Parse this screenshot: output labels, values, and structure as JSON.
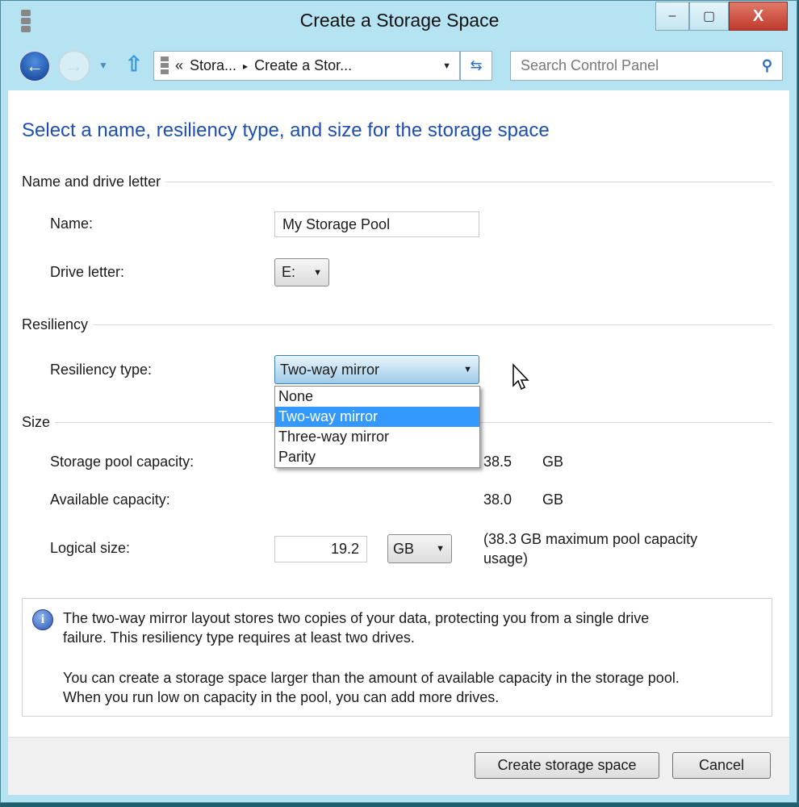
{
  "window": {
    "title": "Create a Storage Space",
    "minimize": "–",
    "maximize": "▢",
    "close": "X"
  },
  "nav": {
    "breadcrumb_prefix": "«",
    "crumb1": "Stora...",
    "separator": "▸",
    "crumb2": "Create a Stor...",
    "search_placeholder": "Search Control Panel"
  },
  "heading": "Select a name, resiliency type, and size for the storage space",
  "name_section": {
    "title": "Name and drive letter",
    "name_label": "Name:",
    "name_value": "My Storage Pool",
    "drive_label": "Drive letter:",
    "drive_value": "E:"
  },
  "resiliency": {
    "title": "Resiliency",
    "type_label": "Resiliency type:",
    "selected": "Two-way mirror",
    "options": [
      "None",
      "Two-way mirror",
      "Three-way mirror",
      "Parity"
    ]
  },
  "size": {
    "title": "Size",
    "pool_label": "Storage pool capacity:",
    "pool_value": "38.5",
    "pool_unit": "GB",
    "avail_label": "Available capacity:",
    "avail_value": "38.0",
    "avail_unit": "GB",
    "logical_label": "Logical size:",
    "logical_value": "19.2",
    "logical_unit": "GB",
    "note_line1": "(38.3 GB maximum pool capacity",
    "note_line2": "usage)"
  },
  "info": {
    "p1_line1": "The two-way mirror layout stores two copies of your data, protecting you from a single drive",
    "p1_line2": "failure. This resiliency type requires at least two drives.",
    "p2_line1": "You can create a storage space larger than the amount of available capacity in the storage pool.",
    "p2_line2": "When you run low on capacity in the pool, you can add more drives."
  },
  "buttons": {
    "create": "Create storage space",
    "cancel": "Cancel"
  },
  "colors": {
    "accent": "#1e4fb0",
    "frame": "#b6e3f1",
    "highlight": "#3399ff"
  }
}
